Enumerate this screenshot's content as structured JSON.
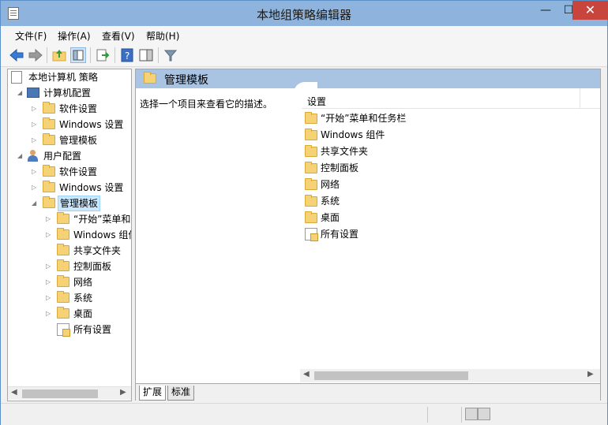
{
  "window": {
    "title": "本地组策略编辑器",
    "min_glyph": "—",
    "max_glyph": "☐",
    "close_glyph": "✕"
  },
  "menu": {
    "items": [
      "文件(F)",
      "操作(A)",
      "查看(V)",
      "帮助(H)"
    ]
  },
  "toolbar": {
    "icons": [
      "back-arrow-icon",
      "forward-arrow-icon",
      "up-folder-icon",
      "show-hide-tree-icon",
      "export-list-icon",
      "help-icon",
      "show-hide-action-pane-icon",
      "filter-icon"
    ]
  },
  "tree": {
    "root": "本地计算机 策略",
    "computer_config": "计算机配置",
    "c_software": "软件设置",
    "c_windows": "Windows 设置",
    "c_admin": "管理模板",
    "user_config": "用户配置",
    "u_software": "软件设置",
    "u_windows": "Windows 设置",
    "u_admin": "管理模板",
    "sub": {
      "start": "“开始”菜单和",
      "windows": "Windows 组件",
      "shared": "共享文件夹",
      "control": "控制面板",
      "network": "网络",
      "system": "系统",
      "desktop": "桌面",
      "all": "所有设置"
    }
  },
  "right": {
    "header": "管理模板",
    "description": "选择一个项目来查看它的描述。",
    "column": "设置",
    "items": {
      "start": "“开始”菜单和任务栏",
      "windows": "Windows 组件",
      "shared": "共享文件夹",
      "control": "控制面板",
      "network": "网络",
      "system": "系统",
      "desktop": "桌面",
      "all": "所有设置"
    },
    "tabs": {
      "extended": "扩展",
      "standard": "标准"
    }
  }
}
